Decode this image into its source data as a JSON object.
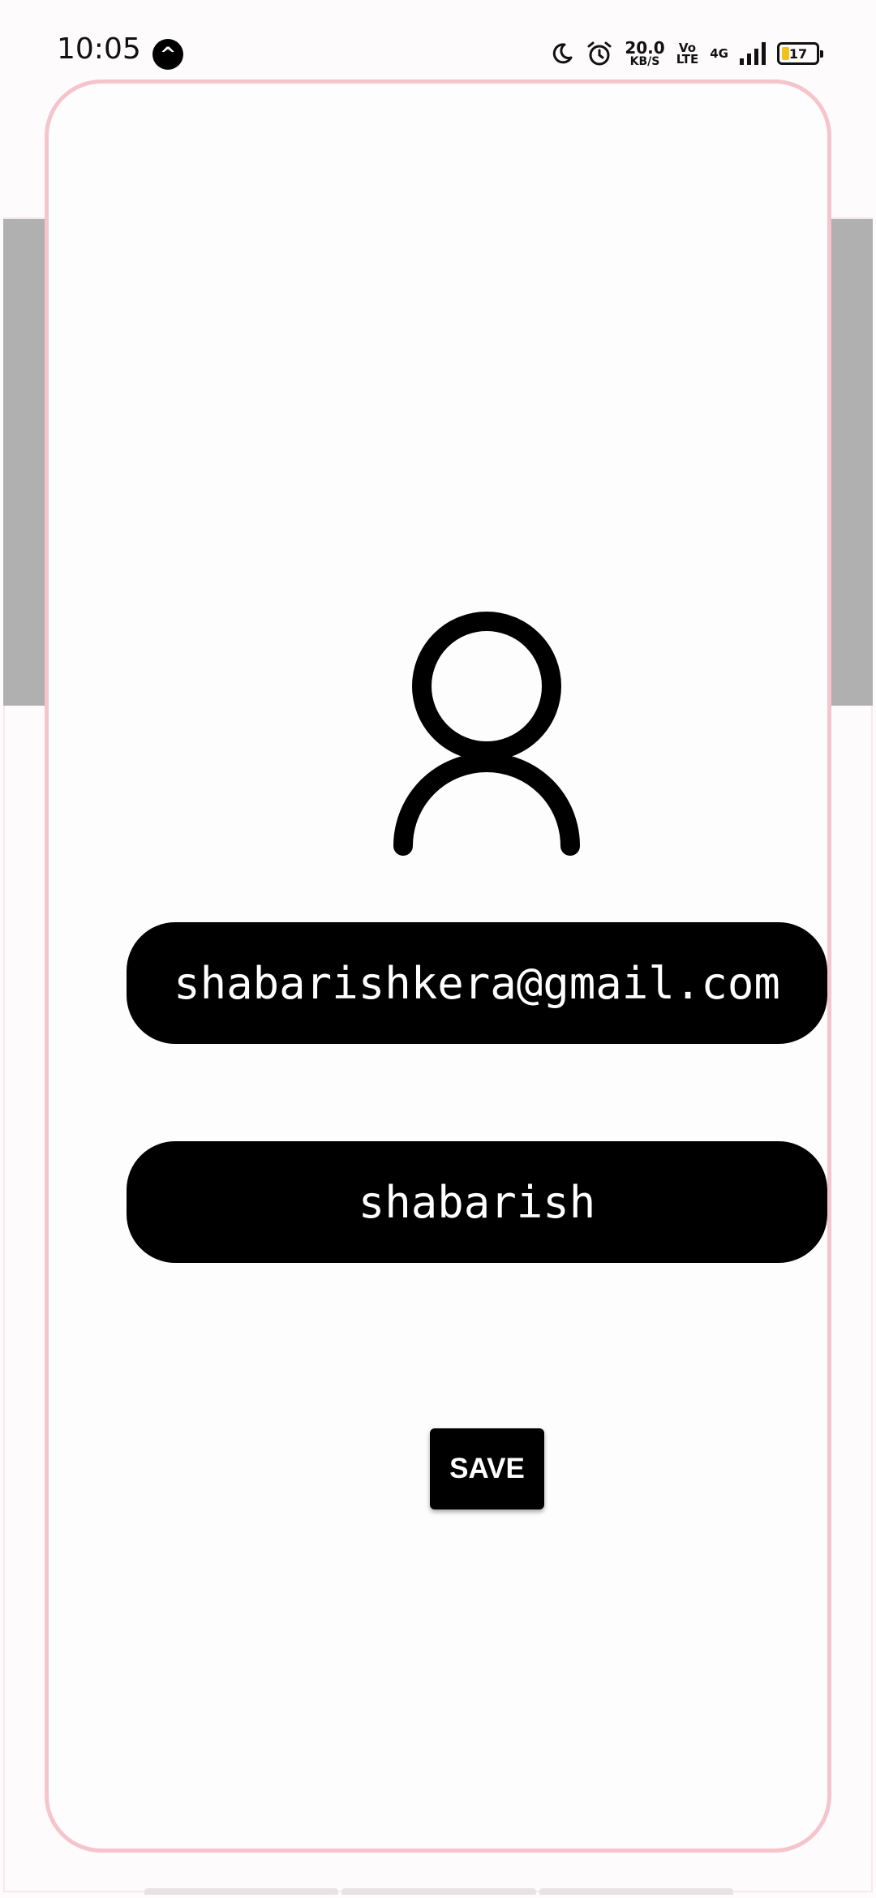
{
  "status_bar": {
    "time": "10:05",
    "app_badge": "^",
    "net_speed_value": "20.0",
    "net_speed_unit": "KB/S",
    "volte_top": "Vo",
    "volte_bottom": "LTE",
    "network_type": "4G",
    "battery_level": "17",
    "icons": [
      "notification-app-icon",
      "moon-icon",
      "alarm-icon",
      "signal-icon",
      "battery-icon"
    ]
  },
  "profile": {
    "avatar_icon": "user-icon",
    "email": "shabarishkera@gmail.com",
    "name": "shabarish"
  },
  "actions": {
    "save_label": "SAVE"
  },
  "colors": {
    "dialog_border": "#f6c4cc",
    "field_background": "#000000",
    "field_text": "#ffffff",
    "background_header": "#b0b0b0",
    "battery_fill": "#f2c21a"
  }
}
